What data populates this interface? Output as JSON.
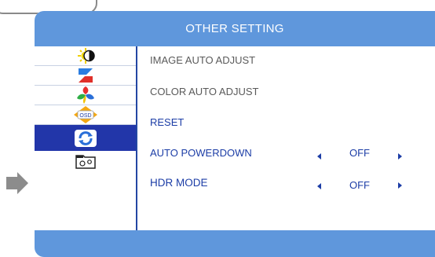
{
  "header": {
    "title": "OTHER SETTING"
  },
  "sidebar": {
    "icons": [
      {
        "name": "brightness-contrast-icon"
      },
      {
        "name": "image-adjust-icon"
      },
      {
        "name": "color-icon"
      },
      {
        "name": "osd-icon"
      },
      {
        "name": "other-setting-icon",
        "active": true
      },
      {
        "name": "system-info-icon"
      }
    ]
  },
  "menu": {
    "items": [
      {
        "label": "IMAGE AUTO ADJUST"
      },
      {
        "label": "COLOR AUTO ADJUST"
      },
      {
        "label": "RESET"
      },
      {
        "label": "AUTO POWERDOWN",
        "value": "OFF"
      },
      {
        "label": "HDR MODE",
        "value": "OFF",
        "selected": true
      }
    ]
  },
  "colors": {
    "header_bg": "#5f97dc",
    "active_bg": "#2236a9",
    "text_accent": "#1c3da6",
    "text_gray": "#5a5a5a"
  }
}
